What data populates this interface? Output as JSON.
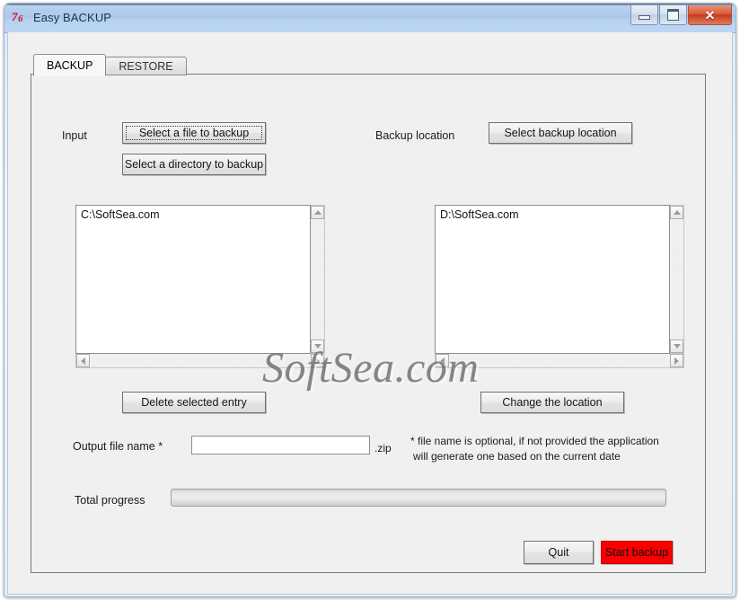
{
  "window": {
    "title": "Easy BACKUP",
    "icon": "autoit-app-icon",
    "controls": {
      "minimize": "minimize-button",
      "maximize": "maximize-button",
      "close": "close-button",
      "close_glyph": "✕"
    },
    "accent_red": "#fa0000",
    "titlebar_blue": "#b1cced"
  },
  "tabs": [
    {
      "label": "BACKUP",
      "active": true
    },
    {
      "label": "RESTORE",
      "active": false
    }
  ],
  "backup_tab": {
    "input_label": "Input",
    "select_file_button": "Select a file to backup",
    "select_directory_button": "Select a directory to backup",
    "backup_location_label": "Backup location",
    "select_backup_location_button": "Select backup location",
    "source_list": {
      "items": [
        "C:\\SoftSea.com"
      ]
    },
    "destination_list": {
      "items": [
        "D:\\SoftSea.com"
      ]
    },
    "delete_entry_button": "Delete selected entry",
    "change_location_button": "Change the location",
    "output_file_name_label": "Output file name  *",
    "output_file_name_value": "",
    "output_file_name_placeholder": "",
    "output_extension": ".zip",
    "note_line1": "* file name is optional, if not provided the application",
    "note_line2": "will generate one based on the current date",
    "total_progress_label": "Total progress",
    "total_progress_percent": 0,
    "quit_button": "Quit",
    "start_backup_button": "Start backup"
  },
  "watermark": "SoftSea.com"
}
